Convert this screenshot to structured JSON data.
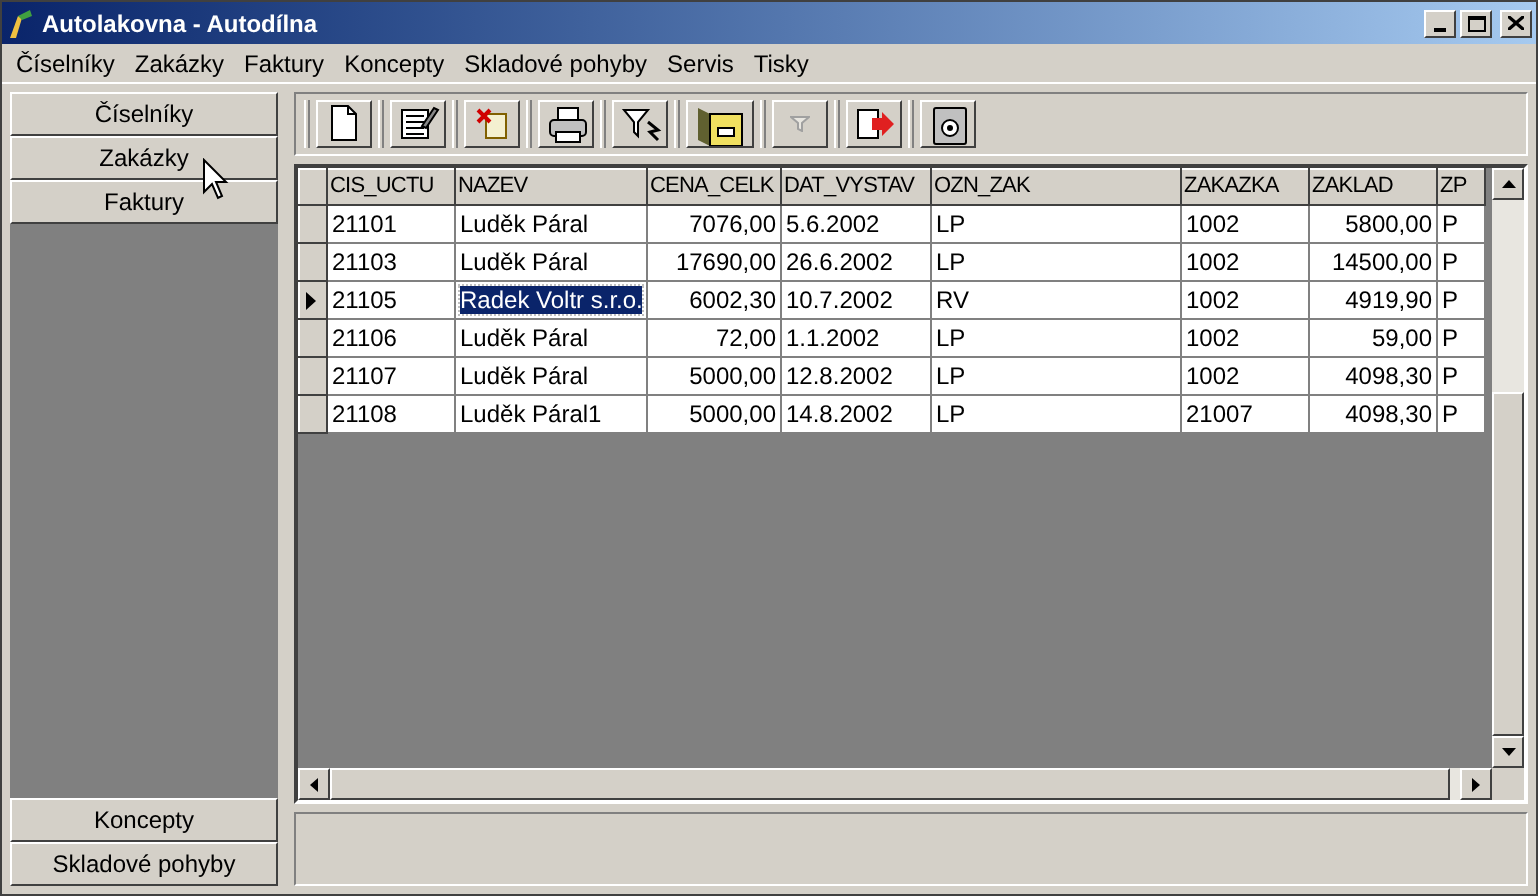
{
  "window": {
    "title": "Autolakovna - Autodílna"
  },
  "menu": [
    "Číselníky",
    "Zakázky",
    "Faktury",
    "Koncepty",
    "Skladové pohyby",
    "Servis",
    "Tisky"
  ],
  "sidebar": {
    "top_items": [
      {
        "label": "Číselníky",
        "selected": false
      },
      {
        "label": "Zakázky",
        "selected": false
      },
      {
        "label": "Faktury",
        "selected": false
      }
    ],
    "bottom_items": [
      {
        "label": "Koncepty",
        "selected": false
      },
      {
        "label": "Skladové pohyby",
        "selected": false
      }
    ]
  },
  "toolbar": [
    {
      "kind": "new",
      "disabled": false
    },
    {
      "kind": "edit",
      "disabled": false
    },
    {
      "kind": "delete",
      "disabled": false
    },
    {
      "kind": "print",
      "disabled": false
    },
    {
      "kind": "filter",
      "disabled": false
    },
    {
      "kind": "archive",
      "disabled": false
    },
    {
      "kind": "filter",
      "disabled": true
    },
    {
      "kind": "export",
      "disabled": false
    },
    {
      "kind": "safe",
      "disabled": false
    }
  ],
  "table": {
    "columns": [
      "CIS_UCTU",
      "NAZEV",
      "CENA_CELK",
      "DAT_VYSTAV",
      "OZN_ZAK",
      "ZAKAZKA",
      "ZAKLAD",
      "ZP"
    ],
    "rows": [
      {
        "selected": false,
        "cells": [
          "21101",
          "Luděk Páral",
          "7076,00",
          "5.6.2002",
          "LP",
          "1002",
          "5800,00",
          "P"
        ]
      },
      {
        "selected": false,
        "cells": [
          "21103",
          "Luděk Páral",
          "17690,00",
          "26.6.2002",
          "LP",
          "1002",
          "14500,00",
          "P"
        ]
      },
      {
        "selected": true,
        "cells": [
          "21105",
          "Radek Voltr s.r.o.",
          "6002,30",
          "10.7.2002",
          "RV",
          "1002",
          "4919,90",
          "P"
        ]
      },
      {
        "selected": false,
        "cells": [
          "21106",
          "Luděk Páral",
          "72,00",
          "1.1.2002",
          "LP",
          "1002",
          "59,00",
          "P"
        ]
      },
      {
        "selected": false,
        "cells": [
          "21107",
          "Luděk Páral",
          "5000,00",
          "12.8.2002",
          "LP",
          "1002",
          "4098,30",
          "P"
        ]
      },
      {
        "selected": false,
        "cells": [
          "21108",
          "Luděk Páral1",
          "5000,00",
          "14.8.2002",
          "LP",
          "21007",
          "4098,30",
          "P"
        ]
      }
    ]
  }
}
